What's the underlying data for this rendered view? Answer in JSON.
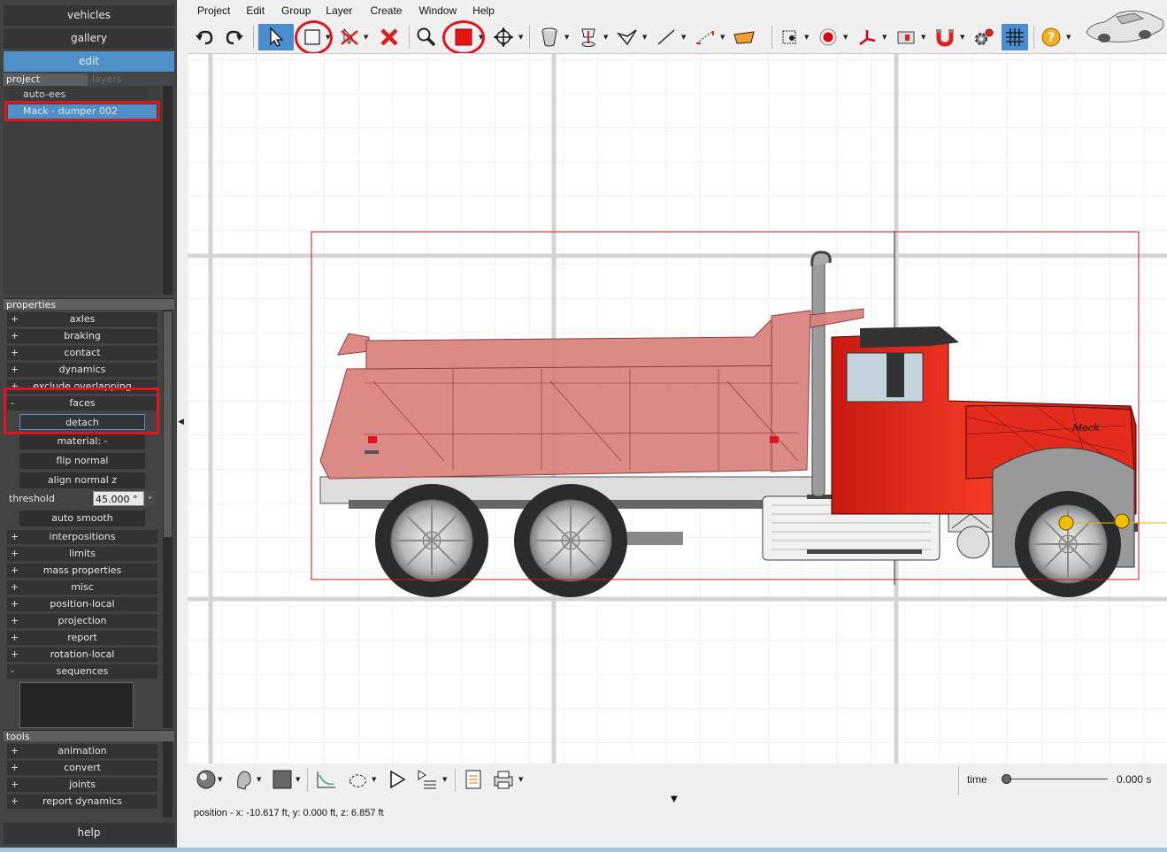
{
  "nav": {
    "vehicles": "vehicles",
    "gallery": "gallery",
    "edit": "edit",
    "help": "help"
  },
  "project_panel": {
    "tab_project": "project",
    "tab_layers": "layers",
    "items": [
      "auto-ees",
      "Mack - dumper 002"
    ]
  },
  "properties": {
    "header": "properties",
    "rows_top": [
      {
        "sign": "+",
        "label": "axles"
      },
      {
        "sign": "+",
        "label": "braking"
      },
      {
        "sign": "+",
        "label": "contact"
      },
      {
        "sign": "+",
        "label": "dynamics"
      },
      {
        "sign": "+",
        "label": "exclude overlapping"
      }
    ],
    "faces": {
      "sign": "-",
      "label": "faces"
    },
    "faces_actions": {
      "detach": "detach",
      "material": "material: -",
      "flip_normal": "flip normal",
      "align_normal_z": "align normal z",
      "threshold_label": "threshold",
      "threshold_value": "45.000 °",
      "auto_smooth": "auto smooth"
    },
    "rows_bottom": [
      {
        "sign": "+",
        "label": "interpositions"
      },
      {
        "sign": "+",
        "label": "limits"
      },
      {
        "sign": "+",
        "label": "mass properties"
      },
      {
        "sign": "+",
        "label": "misc"
      },
      {
        "sign": "+",
        "label": "position-local"
      },
      {
        "sign": "+",
        "label": "projection"
      },
      {
        "sign": "+",
        "label": "report"
      },
      {
        "sign": "+",
        "label": "rotation-local"
      },
      {
        "sign": "-",
        "label": "sequences"
      }
    ]
  },
  "tools": {
    "header": "tools",
    "rows": [
      {
        "sign": "+",
        "label": "animation"
      },
      {
        "sign": "+",
        "label": "convert"
      },
      {
        "sign": "+",
        "label": "joints"
      },
      {
        "sign": "+",
        "label": "report dynamics"
      }
    ]
  },
  "menubar": [
    "Project",
    "Edit",
    "Group",
    "Layer",
    "Create",
    "Window",
    "Help"
  ],
  "truck": {
    "logo_text": "Mack"
  },
  "status": {
    "position": "position - x: -10.617 ft, y: 0.000 ft, z: 6.857 ft",
    "time_label": "time",
    "time_value": "0.000 s",
    "time_progress": 0
  },
  "colors": {
    "accent": "#4f90c9",
    "highlight": "#e0151f",
    "truck_red": "#e8281b",
    "bed_pink": "#d9817c"
  }
}
